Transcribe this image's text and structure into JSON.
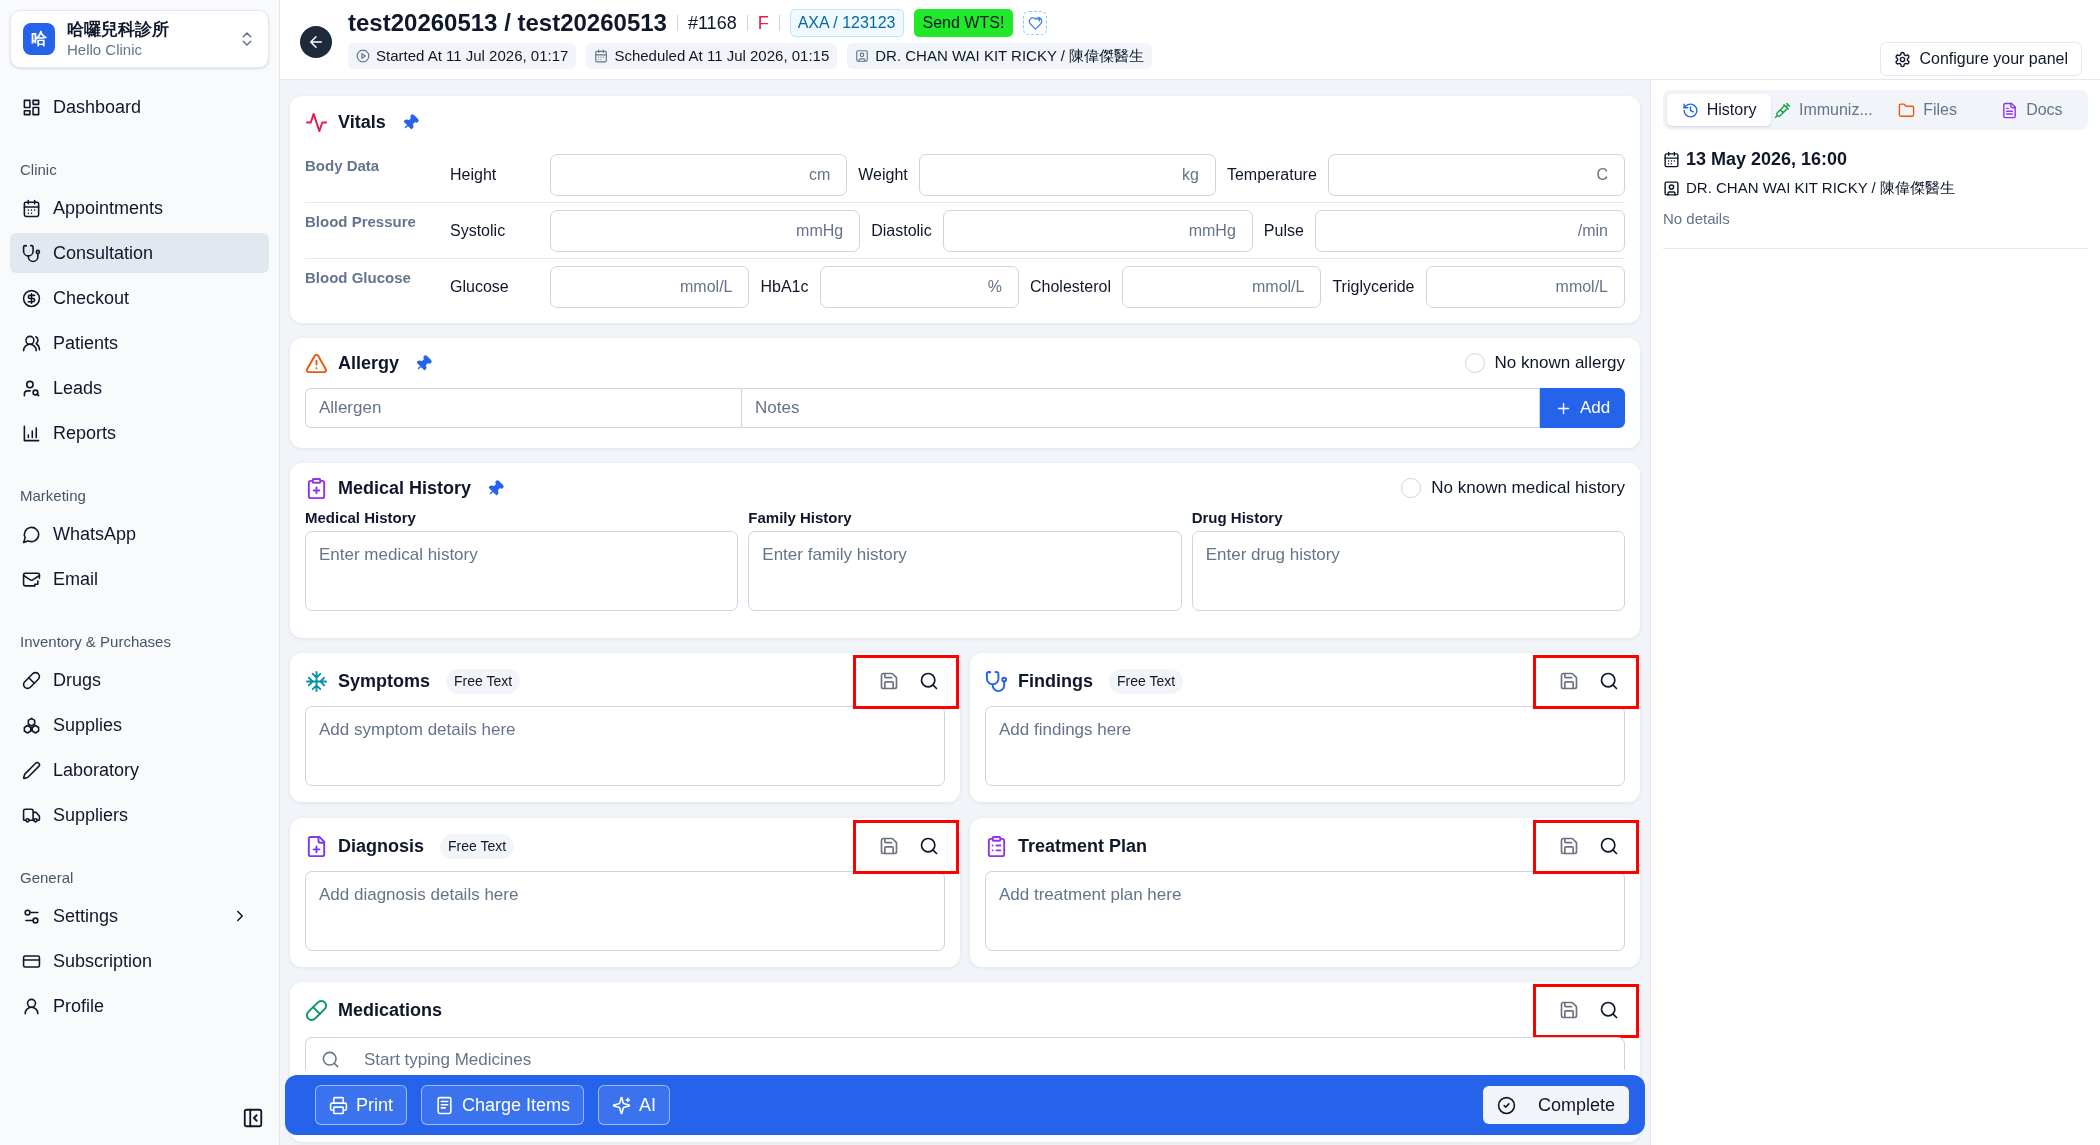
{
  "clinic": {
    "badge": "哈",
    "name": "哈囉兒科診所",
    "subtitle": "Hello Clinic"
  },
  "sidebar": {
    "sections": [
      {
        "items": [
          {
            "label": "Dashboard",
            "selected": false,
            "submenu": false
          }
        ]
      },
      {
        "heading": "Clinic",
        "items": [
          {
            "label": "Appointments",
            "selected": false,
            "submenu": false
          },
          {
            "label": "Consultation",
            "selected": true,
            "submenu": false
          },
          {
            "label": "Checkout",
            "selected": false,
            "submenu": false
          },
          {
            "label": "Patients",
            "selected": false,
            "submenu": false
          },
          {
            "label": "Leads",
            "selected": false,
            "submenu": false
          },
          {
            "label": "Reports",
            "selected": false,
            "submenu": false
          }
        ]
      },
      {
        "heading": "Marketing",
        "items": [
          {
            "label": "WhatsApp",
            "selected": false,
            "submenu": false
          },
          {
            "label": "Email",
            "selected": false,
            "submenu": false
          }
        ]
      },
      {
        "heading": "Inventory & Purchases",
        "items": [
          {
            "label": "Drugs",
            "selected": false,
            "submenu": false
          },
          {
            "label": "Supplies",
            "selected": false,
            "submenu": false
          },
          {
            "label": "Laboratory",
            "selected": false,
            "submenu": false
          },
          {
            "label": "Suppliers",
            "selected": false,
            "submenu": false
          }
        ]
      },
      {
        "heading": "General",
        "items": [
          {
            "label": "Settings",
            "selected": false,
            "submenu": true
          },
          {
            "label": "Subscription",
            "selected": false,
            "submenu": false
          },
          {
            "label": "Profile",
            "selected": false,
            "submenu": false
          }
        ]
      }
    ]
  },
  "header": {
    "title": "test20260513 / test20260513",
    "number": "#1168",
    "gender": "F",
    "insurance": "AXA / 123123",
    "send_button": "Send WTS!",
    "chips": [
      {
        "label": "Started At",
        "value": "11 Jul 2026, 01:17"
      },
      {
        "label": "Scheduled At",
        "value": "11 Jul 2026, 01:15"
      },
      {
        "value": "DR. CHAN WAI KIT RICKY / 陳偉傑醫生"
      }
    ],
    "configure_button": "Configure your panel"
  },
  "vitals": {
    "title": "Vitals",
    "pinned": true,
    "rows": [
      {
        "group": "Body Data",
        "fields": [
          {
            "label": "Height",
            "unit": "cm"
          },
          {
            "label": "Weight",
            "unit": "kg"
          },
          {
            "label": "Temperature",
            "unit": "C"
          }
        ]
      },
      {
        "group": "Blood Pressure",
        "fields": [
          {
            "label": "Systolic",
            "unit": "mmHg"
          },
          {
            "label": "Diastolic",
            "unit": "mmHg"
          },
          {
            "label": "Pulse",
            "unit": "/min"
          }
        ]
      },
      {
        "group": "Blood Glucose",
        "fields": [
          {
            "label": "Glucose",
            "unit": "mmol/L"
          },
          {
            "label": "HbA1c",
            "unit": "%"
          },
          {
            "label": "Cholesterol",
            "unit": "mmol/L"
          },
          {
            "label": "Triglyceride",
            "unit": "mmol/L"
          }
        ]
      }
    ]
  },
  "allergy": {
    "title": "Allergy",
    "pinned": true,
    "none_option": {
      "label": "No known allergy",
      "checked": false
    },
    "allergen_placeholder": "Allergen",
    "notes_placeholder": "Notes",
    "add_button": "Add"
  },
  "medical_history": {
    "title": "Medical History",
    "pinned": true,
    "none_option": {
      "label": "No known medical history",
      "checked": false
    },
    "fields": [
      {
        "label": "Medical History",
        "placeholder": "Enter medical history"
      },
      {
        "label": "Family History",
        "placeholder": "Enter family history"
      },
      {
        "label": "Drug History",
        "placeholder": "Enter drug history"
      }
    ]
  },
  "notes": [
    {
      "title": "Symptoms",
      "tag": "Free Text",
      "placeholder": "Add symptom details here",
      "highlighted": true
    },
    {
      "title": "Findings",
      "tag": "Free Text",
      "placeholder": "Add findings here",
      "highlighted": true
    },
    {
      "title": "Diagnosis",
      "tag": "Free Text",
      "placeholder": "Add diagnosis details here",
      "highlighted": true
    },
    {
      "title": "Treatment Plan",
      "placeholder": "Add treatment plan here",
      "highlighted": true
    }
  ],
  "medications": {
    "title": "Medications",
    "placeholder": "Start typing Medicines",
    "highlighted": true
  },
  "action_bar": {
    "buttons": [
      "Print",
      "Charge Items",
      "AI"
    ],
    "complete_button": "Complete"
  },
  "right_panel": {
    "tabs": [
      {
        "label": "History",
        "selected": true
      },
      {
        "label": "Immuniz...",
        "selected": false
      },
      {
        "label": "Files",
        "selected": false
      },
      {
        "label": "Docs",
        "selected": false
      }
    ],
    "entry": {
      "date": "13 May 2026, 16:00",
      "doctor": "DR. CHAN WAI KIT RICKY / 陳偉傑醫生",
      "details": "No details"
    }
  }
}
